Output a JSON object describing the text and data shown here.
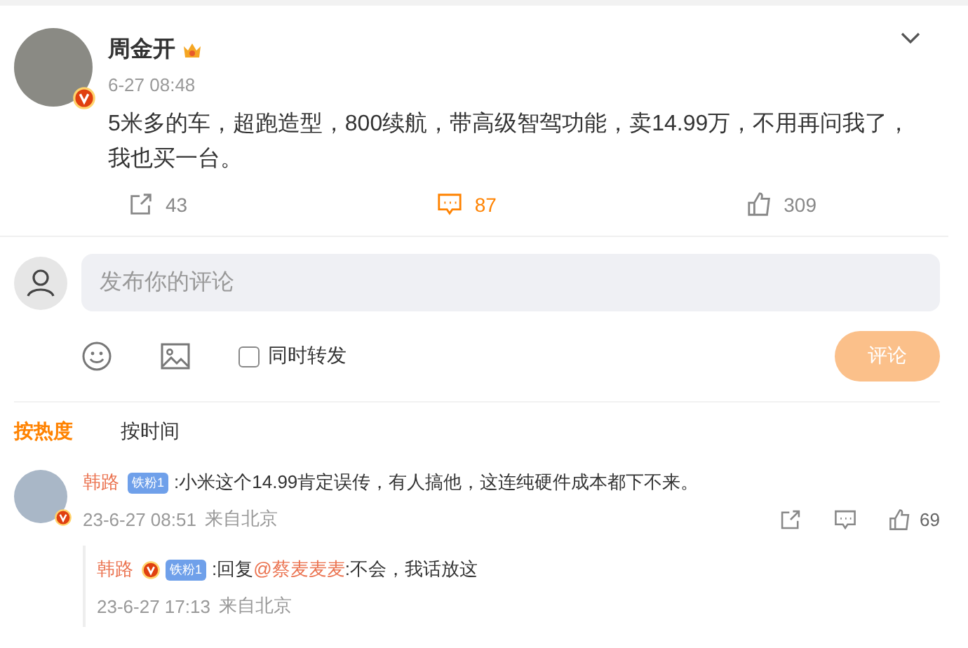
{
  "post": {
    "author": "周金开",
    "verified": true,
    "time": "6-27 08:48",
    "text": "5米多的车，超跑造型，800续航，带高级智驾功能，卖14.99万，不用再问我了，我也买一台。",
    "actions": [
      {
        "kind": "repost",
        "count": "43",
        "selected": false
      },
      {
        "kind": "comment",
        "count": "87",
        "selected": true
      },
      {
        "kind": "like",
        "count": "309",
        "selected": false
      }
    ]
  },
  "composer": {
    "placeholder": "发布你的评论",
    "repost_label": "同时转发",
    "repost_checked": false,
    "submit": "评论",
    "submit_disabled": true
  },
  "sort_tabs": [
    {
      "label": "按热度",
      "selected": true
    },
    {
      "label": "按时间",
      "selected": false
    }
  ],
  "comments": [
    {
      "author": "韩路",
      "verified": true,
      "badge": "铁粉1",
      "text": ":小米这个14.99肯定误传，有人搞他，这连纯硬件成本都下不来。",
      "time": "23-6-27 08:51",
      "location": "来自北京",
      "likes": "69",
      "replies": [
        {
          "author": "韩路",
          "verified": true,
          "badge": "铁粉1",
          "prefix": ":回复",
          "mention": "@蔡麦麦麦",
          "text": ":不会，我话放这",
          "time": "23-6-27 17:13",
          "location": "来自北京"
        }
      ]
    }
  ]
}
